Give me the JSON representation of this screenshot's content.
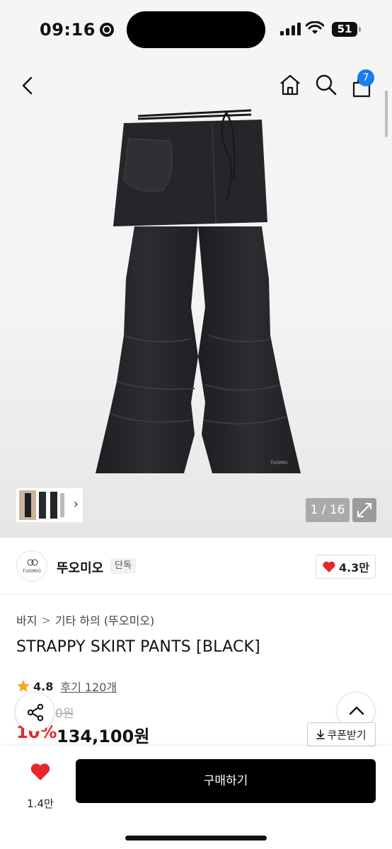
{
  "status_bar": {
    "time": "09:16",
    "battery": "51"
  },
  "nav": {
    "cart_count": "7"
  },
  "gallery": {
    "pager": "1 / 16"
  },
  "brand": {
    "logo_text": "TUOMIO",
    "name": "뚜오미오",
    "badge": "단독",
    "likes": "4.3만",
    "product_logo_text": "TUOMIO"
  },
  "breadcrumb": {
    "level1": "바지",
    "separator": ">",
    "level2": "기타 하의 (뚜오미오)"
  },
  "product": {
    "title": "STRAPPY SKIRT PANTS [BLACK]",
    "rating": "4.8",
    "reviews": "후기 120개",
    "original_price": "0원",
    "discount": "10%",
    "price": "134,100원",
    "coupon_label": "쿠폰받기"
  },
  "bottom": {
    "wish_count": "1.4만",
    "buy_label": "구매하기"
  },
  "colors": {
    "accent_red": "#e8262c",
    "badge_blue": "#1a7cf0",
    "buy_black": "#000000"
  }
}
